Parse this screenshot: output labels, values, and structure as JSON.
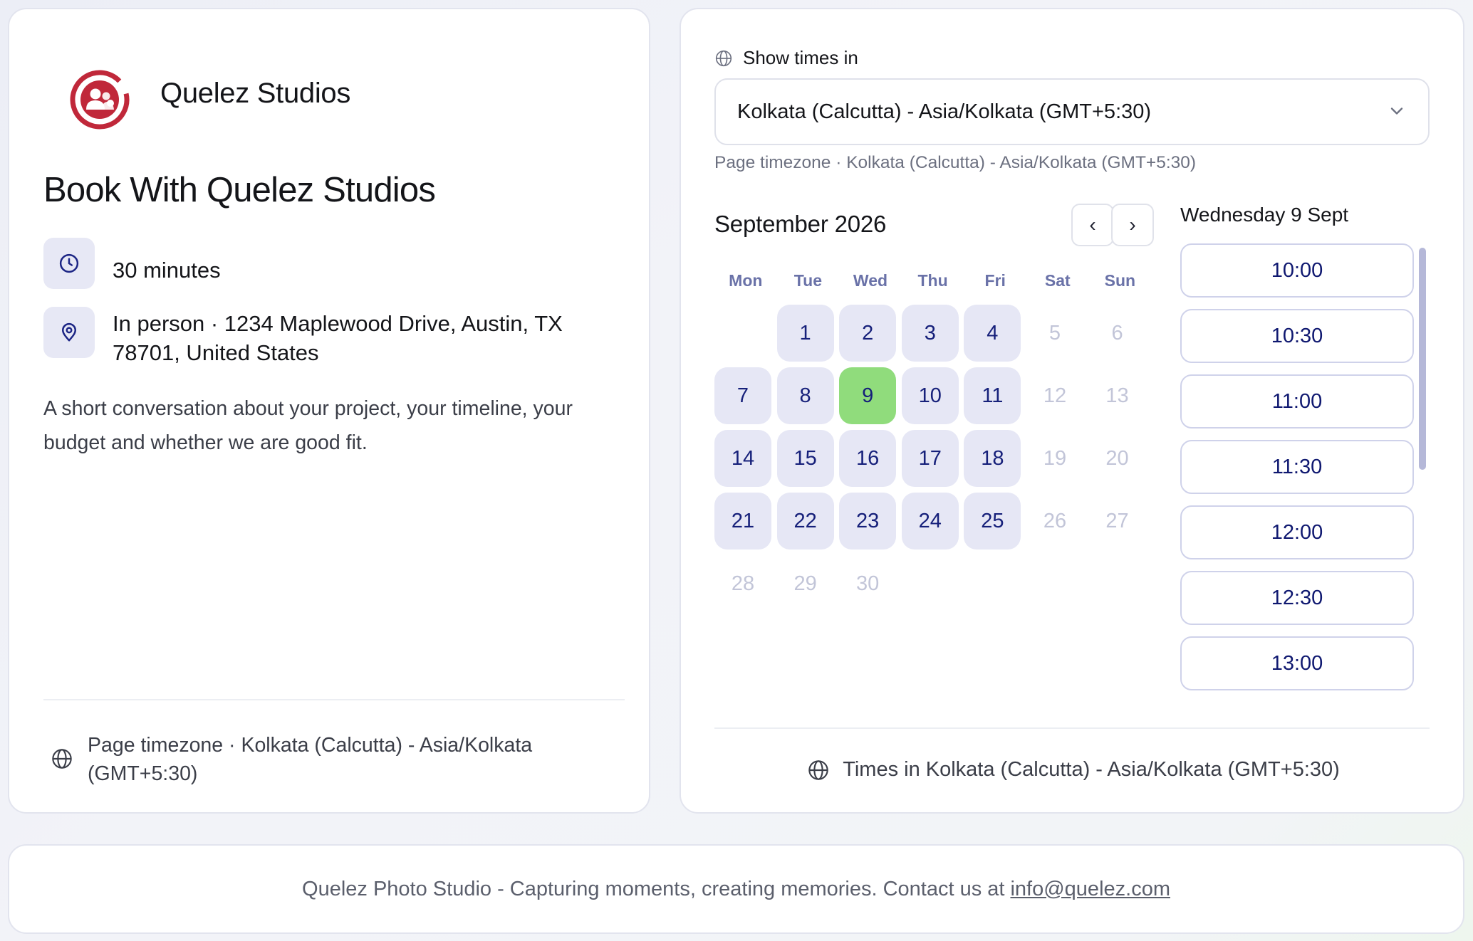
{
  "brand": {
    "name": "Quelez Studios",
    "logo_icon": "people-group-icon",
    "logo_color": "#c0283a"
  },
  "event": {
    "title": "Book With Quelez Studios",
    "duration": "30 minutes",
    "location": "In person · 1234 Maplewood Drive, Austin, TX 78701, United States",
    "description": "A short conversation about your project, your timeline, your budget and whether we are good fit.",
    "page_timezone": "Page timezone · Kolkata (Calcutta) - Asia/Kolkata (GMT+5:30)"
  },
  "scheduler": {
    "show_times_label": "Show times in",
    "timezone_selected": "Kolkata (Calcutta) - Asia/Kolkata (GMT+5:30)",
    "page_timezone_note": "Page timezone · Kolkata (Calcutta) - Asia/Kolkata (GMT+5:30)",
    "month_title": "September 2026",
    "prev_label": "‹",
    "next_label": "›",
    "weekdays": [
      "Mon",
      "Tue",
      "Wed",
      "Thu",
      "Fri",
      "Sat",
      "Sun"
    ],
    "leading_blank_days": 1,
    "days": [
      {
        "label": "1",
        "state": "available"
      },
      {
        "label": "2",
        "state": "available"
      },
      {
        "label": "3",
        "state": "available"
      },
      {
        "label": "4",
        "state": "available"
      },
      {
        "label": "5",
        "state": "disabled"
      },
      {
        "label": "6",
        "state": "disabled"
      },
      {
        "label": "7",
        "state": "available"
      },
      {
        "label": "8",
        "state": "available"
      },
      {
        "label": "9",
        "state": "selected"
      },
      {
        "label": "10",
        "state": "available"
      },
      {
        "label": "11",
        "state": "available"
      },
      {
        "label": "12",
        "state": "disabled"
      },
      {
        "label": "13",
        "state": "disabled"
      },
      {
        "label": "14",
        "state": "available"
      },
      {
        "label": "15",
        "state": "available"
      },
      {
        "label": "16",
        "state": "available"
      },
      {
        "label": "17",
        "state": "available"
      },
      {
        "label": "18",
        "state": "available"
      },
      {
        "label": "19",
        "state": "disabled"
      },
      {
        "label": "20",
        "state": "disabled"
      },
      {
        "label": "21",
        "state": "available"
      },
      {
        "label": "22",
        "state": "available"
      },
      {
        "label": "23",
        "state": "available"
      },
      {
        "label": "24",
        "state": "available"
      },
      {
        "label": "25",
        "state": "available"
      },
      {
        "label": "26",
        "state": "disabled"
      },
      {
        "label": "27",
        "state": "disabled"
      },
      {
        "label": "28",
        "state": "disabled"
      },
      {
        "label": "29",
        "state": "disabled"
      },
      {
        "label": "30",
        "state": "disabled"
      }
    ],
    "selected_date_heading": "Wednesday 9 Sept",
    "time_slots": [
      "10:00",
      "10:30",
      "11:00",
      "11:30",
      "12:00",
      "12:30",
      "13:00"
    ],
    "times_in_label": "Times in Kolkata (Calcutta) - Asia/Kolkata (GMT+5:30)"
  },
  "footer": {
    "text": "Quelez Photo Studio - Capturing moments, creating memories. Contact us at",
    "link": "info@quelez.com"
  },
  "colors": {
    "accent_selected": "#90dc7c",
    "day_available_bg": "#e6e7f5",
    "slot_text": "#0f1870"
  }
}
